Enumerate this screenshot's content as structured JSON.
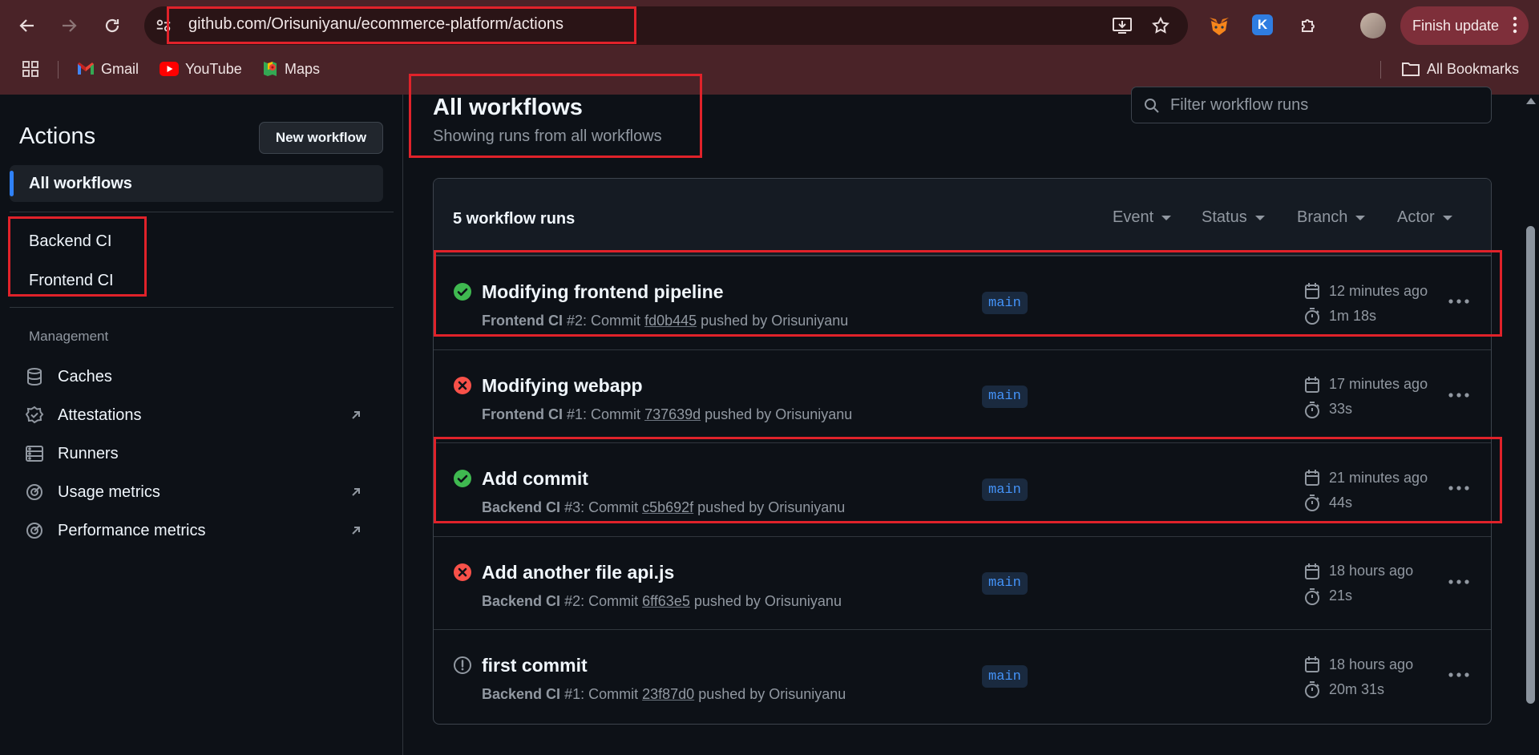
{
  "browser": {
    "url": "github.com/Orisuniyanu/ecommerce-platform/actions",
    "finish_update_label": "Finish update",
    "ext_k_letter": "K",
    "bookmarks": [
      {
        "label": "Gmail",
        "icon": "gmail-icon"
      },
      {
        "label": "YouTube",
        "icon": "youtube-icon"
      },
      {
        "label": "Maps",
        "icon": "maps-icon"
      }
    ],
    "all_bookmarks_label": "All Bookmarks"
  },
  "sidebar": {
    "title": "Actions",
    "new_workflow_label": "New workflow",
    "all_workflows_label": "All workflows",
    "workflows": [
      "Backend CI",
      "Frontend CI"
    ],
    "management_heading": "Management",
    "management_items": [
      {
        "label": "Caches",
        "icon": "database-icon",
        "external": false
      },
      {
        "label": "Attestations",
        "icon": "verified-icon",
        "external": true
      },
      {
        "label": "Runners",
        "icon": "server-icon",
        "external": false
      },
      {
        "label": "Usage metrics",
        "icon": "meter-icon",
        "external": true
      },
      {
        "label": "Performance metrics",
        "icon": "meter-icon",
        "external": true
      }
    ]
  },
  "main": {
    "title": "All workflows",
    "subtitle": "Showing runs from all workflows",
    "filter_placeholder": "Filter workflow runs",
    "runs_count_label": "5 workflow runs",
    "filters": [
      "Event",
      "Status",
      "Branch",
      "Actor"
    ],
    "runs": [
      {
        "status": "success",
        "title": "Modifying frontend pipeline",
        "workflow": "Frontend CI",
        "number": "#2",
        "commit_prefix": ": Commit ",
        "sha": "fd0b445",
        "pushed_by": " pushed by Orisuniyanu",
        "branch": "main",
        "when": "12 minutes ago",
        "duration": "1m 18s",
        "highlighted": true
      },
      {
        "status": "failure",
        "title": "Modifying webapp",
        "workflow": "Frontend CI",
        "number": "#1",
        "commit_prefix": ": Commit ",
        "sha": "737639d",
        "pushed_by": " pushed by Orisuniyanu",
        "branch": "main",
        "when": "17 minutes ago",
        "duration": "33s",
        "highlighted": false
      },
      {
        "status": "success",
        "title": "Add commit",
        "workflow": "Backend CI",
        "number": "#3",
        "commit_prefix": ": Commit ",
        "sha": "c5b692f",
        "pushed_by": " pushed by Orisuniyanu",
        "branch": "main",
        "when": "21 minutes ago",
        "duration": "44s",
        "highlighted": true
      },
      {
        "status": "failure",
        "title": "Add another file api.js",
        "workflow": "Backend CI",
        "number": "#2",
        "commit_prefix": ": Commit ",
        "sha": "6ff63e5",
        "pushed_by": " pushed by Orisuniyanu",
        "branch": "main",
        "when": "18 hours ago",
        "duration": "21s",
        "highlighted": false
      },
      {
        "status": "startup_failure",
        "title": "first commit",
        "workflow": "Backend CI",
        "number": "#1",
        "commit_prefix": ": Commit ",
        "sha": "23f87d0",
        "pushed_by": " pushed by Orisuniyanu",
        "branch": "main",
        "when": "18 hours ago",
        "duration": "20m 31s",
        "highlighted": false
      }
    ]
  },
  "colors": {
    "success": "#3fb950",
    "failure": "#f85149",
    "accent": "#2f81f7",
    "annotation": "#e0222a"
  }
}
